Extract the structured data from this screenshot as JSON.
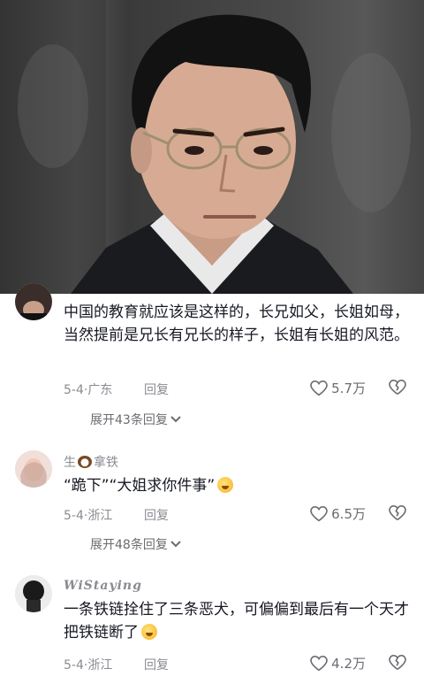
{
  "comments": [
    {
      "text": "中国的教育就应该是这样的，长兄如父，长姐如母，当然提前是兄长有兄长的样子，长姐有长姐的风范。",
      "location": "5-4·广东",
      "reply_label": "回复",
      "likes": "5.7万",
      "expand_label": "展开43条回复"
    },
    {
      "user_prefix": "生",
      "user_suffix": "拿铁",
      "text": "“跪下”“大姐求你件事”",
      "location": "5-4·浙江",
      "reply_label": "回复",
      "likes": "6.5万",
      "expand_label": "展开48条回复"
    },
    {
      "user": "WiStaying",
      "text": "一条铁链拴住了三条恶犬，可偏偏到最后有一个天才把铁链断了",
      "location": "5-4·浙江",
      "reply_label": "回复",
      "likes": "4.2万"
    }
  ]
}
